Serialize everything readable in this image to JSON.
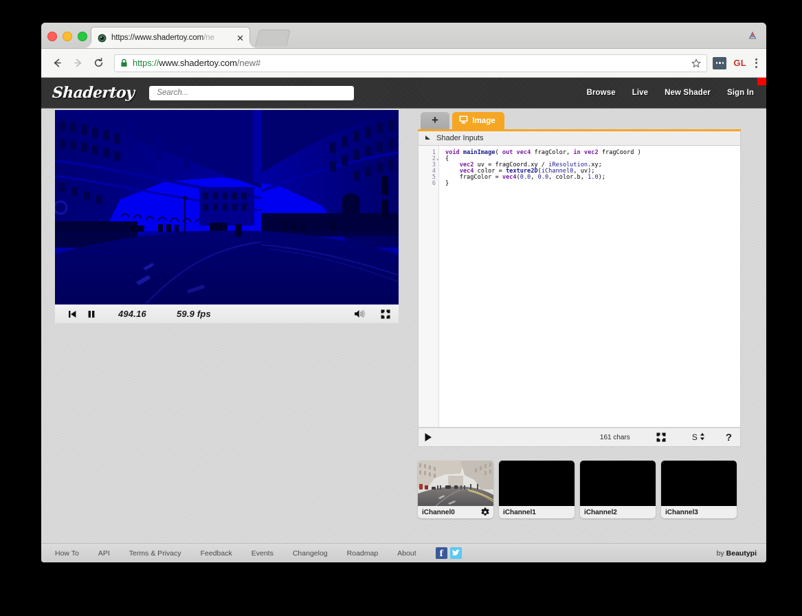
{
  "browser": {
    "tab": {
      "title_main": "https://www.shadertoy.com",
      "title_dim": "/ne",
      "close_label": "✕",
      "favicon_name": "shadertoy-eye-favicon"
    },
    "toolbar": {
      "back_label": "←",
      "forward_label": "→",
      "reload_label": "↻",
      "url_scheme": "https://",
      "url_host": "www.shadertoy.com",
      "url_path": "/new#",
      "bookmark_label": "☆",
      "profile_initials": "GL",
      "menu_label": "kebab-menu"
    }
  },
  "site": {
    "logo": "Shadertoy",
    "search": {
      "placeholder": "Search...",
      "value": ""
    },
    "nav": [
      {
        "label": "Browse"
      },
      {
        "label": "Live"
      },
      {
        "label": "New Shader"
      },
      {
        "label": "Sign In"
      }
    ],
    "marker_color": "#ff0000"
  },
  "preview": {
    "player": {
      "rewind_label": "rewind",
      "pause_label": "pause",
      "time": "494.16",
      "fps": "59.9 fps",
      "volume_label": "volume",
      "fullscreen_label": "fullscreen"
    }
  },
  "editor": {
    "tabs": {
      "add_label": "+",
      "image_label": "Image",
      "image_icon": "monitor-icon"
    },
    "shader_inputs_label": "Shader Inputs",
    "accent_color": "#f5a623",
    "lines": [
      {
        "n": "1",
        "fold": false
      },
      {
        "n": "2",
        "fold": true
      },
      {
        "n": "3",
        "fold": false
      },
      {
        "n": "4",
        "fold": false
      },
      {
        "n": "5",
        "fold": false
      },
      {
        "n": "6",
        "fold": false
      }
    ],
    "code": "void mainImage( out vec4 fragColor, in vec2 fragCoord )\n{\n    vec2 uv = fragCoord.xy / iResolution.xy;\n    vec4 color = texture2D(iChannel0, uv);\n    fragColor = vec4(0.0, 0.0, color.b, 1.0);\n}",
    "footer": {
      "compile_label": "compile-play",
      "char_count": "161 chars",
      "fullscreen_label": "fullscreen",
      "size_label": "S",
      "size_stepper": "↕",
      "help_label": "?"
    }
  },
  "channels": [
    {
      "label": "iChannel0",
      "filled": true,
      "gear": true
    },
    {
      "label": "iChannel1",
      "filled": false,
      "gear": false
    },
    {
      "label": "iChannel2",
      "filled": false,
      "gear": false
    },
    {
      "label": "iChannel3",
      "filled": false,
      "gear": false
    }
  ],
  "footer": {
    "links": [
      {
        "label": "How To"
      },
      {
        "label": "API"
      },
      {
        "label": "Terms & Privacy"
      },
      {
        "label": "Feedback"
      },
      {
        "label": "Events"
      },
      {
        "label": "Changelog"
      },
      {
        "label": "Roadmap"
      },
      {
        "label": "About"
      }
    ],
    "social": [
      {
        "name": "facebook",
        "glyph": "f"
      },
      {
        "name": "twitter",
        "glyph": "t"
      }
    ],
    "credit_prefix": "by ",
    "credit_name": "Beautypi"
  }
}
